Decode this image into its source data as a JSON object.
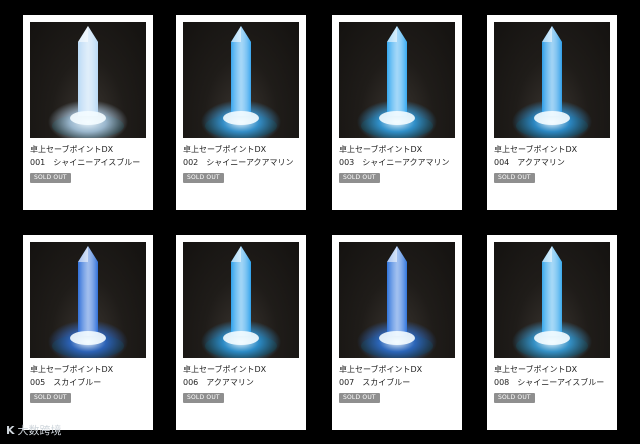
{
  "products": [
    {
      "title": "卓上セーブポイントDX",
      "variant": "001　シャイニーアイスブルー",
      "badge": "SOLD OUT",
      "color": "#b9d9f5"
    },
    {
      "title": "卓上セーブポイントDX",
      "variant": "002　シャイニーアクアマリン",
      "badge": "SOLD OUT",
      "color": "#3aa6ee"
    },
    {
      "title": "卓上セーブポイントDX",
      "variant": "003　シャイニーアクアマリン",
      "badge": "SOLD OUT",
      "color": "#35a8f0"
    },
    {
      "title": "卓上セーブポイントDX",
      "variant": "004　アクアマリン",
      "badge": "SOLD OUT",
      "color": "#2f9ee8"
    },
    {
      "title": "卓上セーブポイントDX",
      "variant": "005　スカイブルー",
      "badge": "SOLD OUT",
      "color": "#2f6fd8"
    },
    {
      "title": "卓上セーブポイントDX",
      "variant": "006　アクアマリン",
      "badge": "SOLD OUT",
      "color": "#2fa2ec"
    },
    {
      "title": "卓上セーブポイントDX",
      "variant": "007　スカイブルー",
      "badge": "SOLD OUT",
      "color": "#2f74dc"
    },
    {
      "title": "卓上セーブポイントDX",
      "variant": "008　シャイニーアイスブルー",
      "badge": "SOLD OUT",
      "color": "#3aa9ec"
    }
  ],
  "watermark": {
    "logo": "K",
    "text": "大数跨境"
  }
}
